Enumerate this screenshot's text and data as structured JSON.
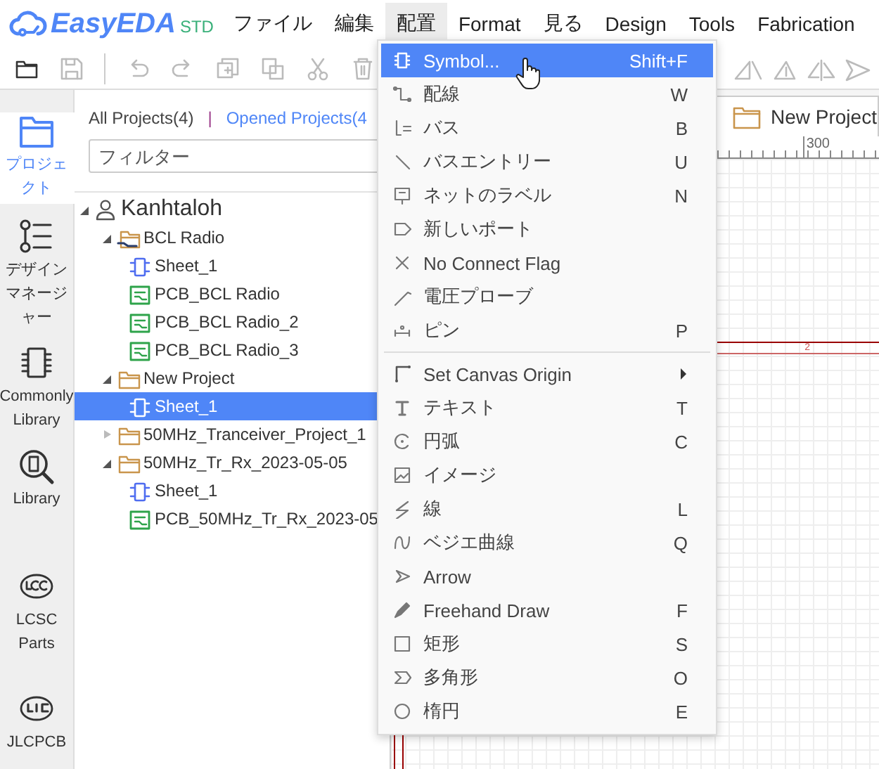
{
  "app": {
    "logo": "EasyEDA",
    "edition": "STD"
  },
  "menubar": [
    {
      "label": "ファイル",
      "selected": false
    },
    {
      "label": "編集",
      "selected": false
    },
    {
      "label": "配置",
      "selected": true
    },
    {
      "label": "Format",
      "selected": false
    },
    {
      "label": "見る",
      "selected": false
    },
    {
      "label": "Design",
      "selected": false
    },
    {
      "label": "Tools",
      "selected": false
    },
    {
      "label": "Fabrication",
      "selected": false
    }
  ],
  "rail": [
    {
      "label": "プロジェクト",
      "selected": true
    },
    {
      "label": "デザインマネージャー",
      "selected": false
    },
    {
      "label": "Commonly Library",
      "selected": false
    },
    {
      "label": "Library",
      "selected": false
    },
    {
      "label": "LCSC Parts",
      "selected": false
    },
    {
      "label": "JLCPCB",
      "selected": false
    }
  ],
  "project_panel": {
    "tabs": [
      {
        "label": "All Projects(4)",
        "selected": false
      },
      {
        "label": "Opened Projects(4",
        "selected": true
      }
    ],
    "separator": "|",
    "filter": {
      "placeholder": "フィルター"
    },
    "tree": [
      {
        "label": "Kanhtaloh",
        "kind": "user",
        "expanded": true,
        "selected": false,
        "children": [
          {
            "label": "BCL Radio",
            "kind": "shared",
            "expanded": true,
            "selected": false,
            "children": [
              {
                "label": "Sheet_1",
                "kind": "schematic",
                "selected": false
              },
              {
                "label": "PCB_BCL Radio",
                "kind": "pcb",
                "selected": false
              },
              {
                "label": "PCB_BCL Radio_2",
                "kind": "pcb",
                "selected": false
              },
              {
                "label": "PCB_BCL Radio_3",
                "kind": "pcb",
                "selected": false
              }
            ]
          },
          {
            "label": "New Project",
            "kind": "project",
            "expanded": true,
            "selected": false,
            "children": [
              {
                "label": "Sheet_1",
                "kind": "schematic",
                "selected": true
              }
            ]
          },
          {
            "label": "50MHz_Tranceiver_Project_1",
            "kind": "project",
            "expanded": false,
            "selected": false
          },
          {
            "label": "50MHz_Tr_Rx_2023-05-05",
            "kind": "project",
            "expanded": true,
            "selected": false,
            "children": [
              {
                "label": "Sheet_1",
                "kind": "schematic",
                "selected": false
              },
              {
                "label": "PCB_50MHz_Tr_Rx_2023-05",
                "kind": "pcb",
                "selected": false
              }
            ]
          }
        ]
      }
    ]
  },
  "canvas": {
    "tab": "New Project",
    "ruler_label": "300",
    "net_label": "2"
  },
  "place_menu": {
    "groups": [
      [
        {
          "label": "Symbol...",
          "shortcut": "Shift+F",
          "selected": true
        },
        {
          "label": "配線",
          "shortcut": "W",
          "selected": false
        },
        {
          "label": "バス",
          "shortcut": "B",
          "selected": false
        },
        {
          "label": "バスエントリー",
          "shortcut": "U",
          "selected": false
        },
        {
          "label": "ネットのラベル",
          "shortcut": "N",
          "selected": false
        },
        {
          "label": "新しいポート",
          "selected": false
        },
        {
          "label": "No Connect Flag",
          "selected": false
        },
        {
          "label": "電圧プローブ",
          "selected": false
        },
        {
          "label": "ピン",
          "shortcut": "P",
          "selected": false
        }
      ],
      [
        {
          "label": "Set Canvas Origin",
          "submenu": true,
          "selected": false
        },
        {
          "label": "テキスト",
          "shortcut": "T",
          "selected": false
        },
        {
          "label": "円弧",
          "shortcut": "C",
          "selected": false
        },
        {
          "label": "イメージ",
          "selected": false
        },
        {
          "label": "線",
          "shortcut": "L",
          "selected": false
        },
        {
          "label": "ベジエ曲線",
          "shortcut": "Q",
          "selected": false
        },
        {
          "label": "Arrow",
          "selected": false
        },
        {
          "label": "Freehand Draw",
          "shortcut": "F",
          "selected": false
        },
        {
          "label": "矩形",
          "shortcut": "S",
          "selected": false
        },
        {
          "label": "多角形",
          "shortcut": "O",
          "selected": false
        },
        {
          "label": "楕円",
          "shortcut": "E",
          "selected": false
        }
      ]
    ]
  }
}
